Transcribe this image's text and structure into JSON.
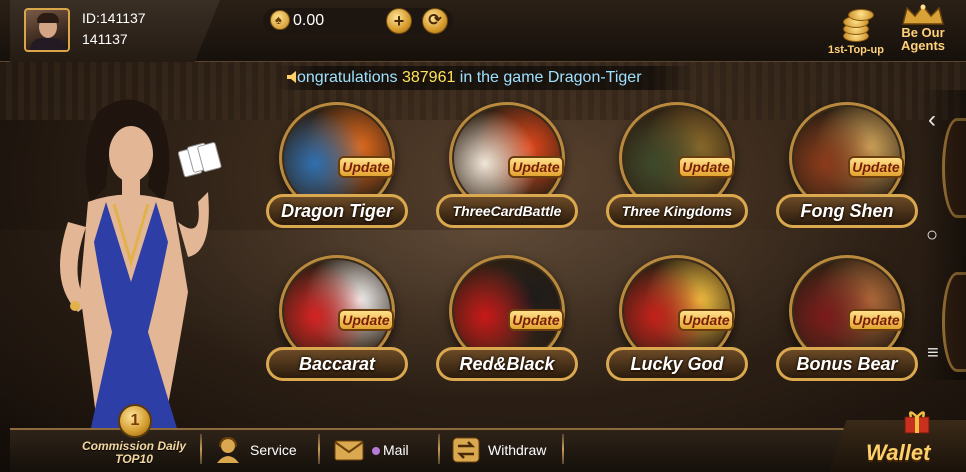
{
  "profile": {
    "id_label": "ID:141137",
    "name": "141137"
  },
  "balance": {
    "value": "0.00",
    "add_icon": "plus-icon",
    "refresh_icon": "refresh-icon"
  },
  "top_right": {
    "top_up_label": "1st-Top-up",
    "agents_label_line1": "Be Our",
    "agents_label_line2": "Agents"
  },
  "marquee": {
    "part1": "ongratulations ",
    "number": "387961",
    "part2": " in the game ",
    "game": "Dragon-Tiger"
  },
  "games": [
    {
      "name": "Dragon Tiger",
      "badge": "Update",
      "colors": [
        "#2f6fb0",
        "#e36a1c"
      ]
    },
    {
      "name": "ThreeCardBattle",
      "badge": "Update",
      "colors": [
        "#f0e6d8",
        "#e0461a"
      ]
    },
    {
      "name": "Three Kingdoms",
      "badge": "Update",
      "colors": [
        "#3d4a2a",
        "#8a6a2a"
      ]
    },
    {
      "name": "Fong Shen",
      "badge": "Update",
      "colors": [
        "#8a3a1a",
        "#cfa45a"
      ]
    },
    {
      "name": "Baccarat",
      "badge": "Update",
      "colors": [
        "#d32222",
        "#f3f3f3"
      ]
    },
    {
      "name": "Red&Black",
      "badge": "Update",
      "colors": [
        "#c81818",
        "#1a1a1a"
      ]
    },
    {
      "name": "Lucky God",
      "badge": "Update",
      "colors": [
        "#c4201a",
        "#f1c040"
      ]
    },
    {
      "name": "Bonus Bear",
      "badge": "Update",
      "colors": [
        "#7a1a1a",
        "#b06a3a"
      ]
    }
  ],
  "bottom": {
    "commission_line1": "Commission Daily",
    "commission_line2": "TOP10",
    "medal_number": "1",
    "service_label": "Service",
    "mail_label": "Mail",
    "withdraw_label": "Withdraw",
    "wallet_label": "Wallet"
  },
  "side_nav": {
    "back_glyph": "‹",
    "home_glyph": "○",
    "menu_glyph": "≡"
  }
}
